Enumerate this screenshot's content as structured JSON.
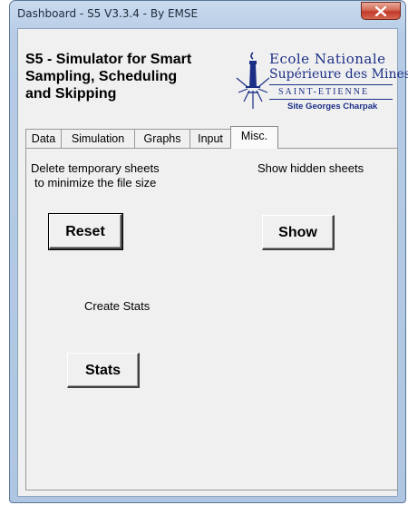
{
  "window": {
    "title": "Dashboard - S5 V3.3.4 - By EMSE"
  },
  "app": {
    "title_line1": "S5 - Simulator for Smart",
    "title_line2": "Sampling, Scheduling",
    "title_line3": "and Skipping"
  },
  "logo": {
    "line1": "Ecole Nationale",
    "line2": "Supérieure des Mines",
    "line3": "SAINT-ETIENNE",
    "line4": "Site Georges Charpak"
  },
  "tabs": [
    {
      "label": "Data"
    },
    {
      "label": "Simulation"
    },
    {
      "label": "Graphs"
    },
    {
      "label": "Input"
    },
    {
      "label": "Misc."
    }
  ],
  "misc": {
    "delete_text_line1": "Delete temporary sheets",
    "delete_text_line2": "to minimize the file size",
    "show_text": "Show hidden sheets",
    "reset_label": "Reset",
    "show_label": "Show",
    "create_stats_text": "Create Stats",
    "stats_label": "Stats"
  },
  "colors": {
    "close_button": "#c0392b",
    "logo_blue": "#1b2f86"
  }
}
